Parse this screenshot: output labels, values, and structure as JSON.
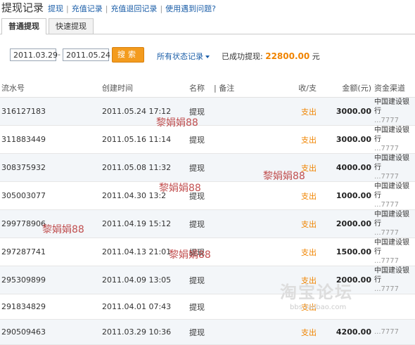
{
  "header": {
    "title": "提现记录",
    "links": [
      "提现",
      "充值记录",
      "充值退回记录",
      "使用遇到问题?"
    ]
  },
  "tabs": [
    {
      "label": "普通提现",
      "active": true
    },
    {
      "label": "快速提现",
      "active": false
    }
  ],
  "filter": {
    "start_date": "2011.03.29",
    "end_date": "2011.05.24",
    "search_label": "搜索",
    "status_label": "所有状态记录",
    "success_label": "已成功提现:",
    "success_amount": "22800.00",
    "currency": "元"
  },
  "table": {
    "columns": [
      "流水号",
      "创建时间",
      "名称",
      "备注",
      "收/支",
      "金额(元)",
      "资金渠道"
    ],
    "rows": [
      {
        "id": "316127183",
        "time": "2011.05.24 17:12",
        "name": "提现",
        "type": "支出",
        "amount": "3000.00",
        "bank": "中国建设银行",
        "card": "...7777"
      },
      {
        "id": "311883449",
        "time": "2011.05.16 11:14",
        "name": "提现",
        "type": "支出",
        "amount": "3000.00",
        "bank": "中国建设银行",
        "card": "...7777"
      },
      {
        "id": "308375932",
        "time": "2011.05.08 11:32",
        "name": "提现",
        "type": "支出",
        "amount": "4000.00",
        "bank": "中国建设银行",
        "card": "...7777"
      },
      {
        "id": "305003077",
        "time": "2011.04.30 13:2",
        "name": "提现",
        "type": "支出",
        "amount": "1000.00",
        "bank": "中国建设银行",
        "card": "...7777"
      },
      {
        "id": "299778906",
        "time": "2011.04.19 15:12",
        "name": "提现",
        "type": "支出",
        "amount": "2000.00",
        "bank": "中国建设银行",
        "card": "...7777"
      },
      {
        "id": "297287741",
        "time": "2011.04.13 21:01",
        "name": "提现",
        "type": "支出",
        "amount": "1500.00",
        "bank": "中国建设银行",
        "card": "...7777"
      },
      {
        "id": "295309899",
        "time": "2011.04.09 13:05",
        "name": "提现",
        "type": "支出",
        "amount": "2000.00",
        "bank": "中国建设银行",
        "card": "...7777"
      },
      {
        "id": "291834829",
        "time": "2011.04.01 07:43",
        "name": "提现",
        "type": "支出",
        "amount": "",
        "bank": "",
        "card": ""
      },
      {
        "id": "290509463",
        "time": "2011.03.29 10:36",
        "name": "提现",
        "type": "支出",
        "amount": "4200.00",
        "bank": "",
        "card": "...7777"
      }
    ]
  },
  "watermarks": [
    "黎娟娟88",
    "黎娟娟88",
    "黎娟娟88",
    "黎娟娟88",
    "黎娟娟88"
  ],
  "site_logo": {
    "text": "淘宝论坛",
    "url": "bbs.taobao.com"
  }
}
